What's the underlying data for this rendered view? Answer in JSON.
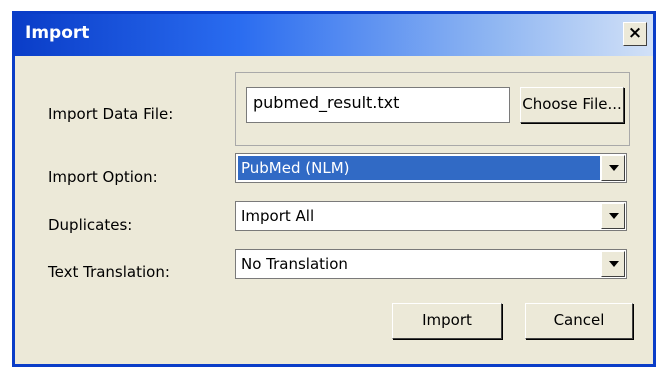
{
  "window": {
    "title": "Import",
    "close_label": "×"
  },
  "fields": {
    "data_file": {
      "label": "Import Data File:",
      "value": "pubmed_result.txt",
      "button": "Choose File..."
    },
    "import_option": {
      "label": "Import Option:",
      "value": "PubMed (NLM)"
    },
    "duplicates": {
      "label": "Duplicates:",
      "value": "Import All"
    },
    "text_translation": {
      "label": "Text Translation:",
      "value": "No Translation"
    }
  },
  "buttons": {
    "import": "Import",
    "cancel": "Cancel"
  },
  "icons": {
    "close": "close-icon",
    "dropdown": "chevron-down-icon"
  },
  "colors": {
    "titlebar": "#0a3dc8",
    "selection": "#316ac5",
    "dialog_bg": "#ece9d8"
  }
}
